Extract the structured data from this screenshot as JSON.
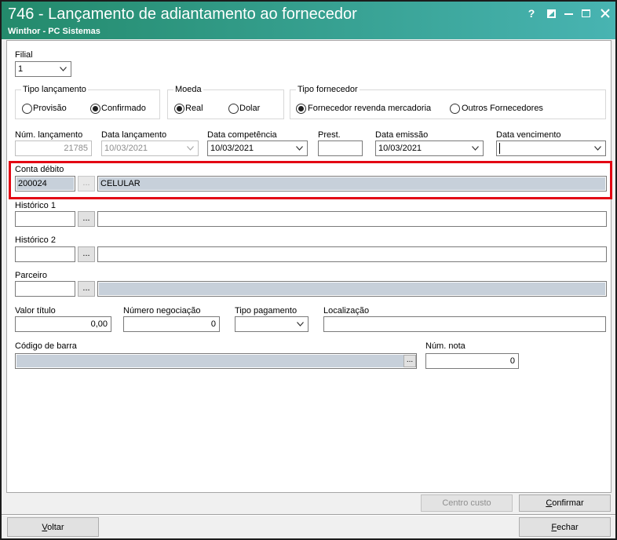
{
  "window": {
    "title": "746 - Lançamento de adiantamento ao fornecedor",
    "subtitle": "Winthor - PC Sistemas",
    "help": "?",
    "control_icons": [
      "help-icon",
      "dock-icon",
      "minimize-icon",
      "maximize-icon",
      "close-icon"
    ]
  },
  "filial": {
    "label": "Filial",
    "value": "1"
  },
  "tipo_lancamento": {
    "legend": "Tipo lançamento",
    "options": [
      {
        "label": "Provisão",
        "checked": false
      },
      {
        "label": "Confirmado",
        "checked": true
      }
    ]
  },
  "moeda": {
    "legend": "Moeda",
    "options": [
      {
        "label": "Real",
        "checked": true
      },
      {
        "label": "Dolar",
        "checked": false
      }
    ]
  },
  "tipo_fornecedor": {
    "legend": "Tipo fornecedor",
    "options": [
      {
        "label": "Fornecedor revenda mercadoria",
        "checked": true
      },
      {
        "label": "Outros Fornecedores",
        "checked": false
      }
    ]
  },
  "num_lancamento": {
    "label": "Núm. lançamento",
    "value": "21785"
  },
  "data_lancamento": {
    "label": "Data lançamento",
    "value": "10/03/2021"
  },
  "data_competencia": {
    "label": "Data competência",
    "value": "10/03/2021"
  },
  "prest": {
    "label": "Prest.",
    "value": ""
  },
  "data_emissao": {
    "label": "Data emissão",
    "value": "10/03/2021"
  },
  "data_vencimento": {
    "label": "Data vencimento",
    "value": ""
  },
  "conta_debito": {
    "label": "Conta débito",
    "code": "200024",
    "browse": "...",
    "description": "CELULAR"
  },
  "historico_1": {
    "label": "Histórico 1",
    "code": "",
    "browse": "...",
    "description": ""
  },
  "historico_2": {
    "label": "Histórico 2",
    "code": "",
    "browse": "...",
    "description": ""
  },
  "parceiro": {
    "label": "Parceiro",
    "code": "",
    "browse": "...",
    "description": ""
  },
  "valor_titulo": {
    "label": "Valor título",
    "value": "0,00"
  },
  "numero_negociacao": {
    "label": "Número negociação",
    "value": "0"
  },
  "tipo_pagamento": {
    "label": "Tipo pagamento",
    "value": ""
  },
  "localizacao": {
    "label": "Localização",
    "value": ""
  },
  "codigo_barra": {
    "label": "Código de barra",
    "value": "",
    "browse": "..."
  },
  "num_nota": {
    "label": "Núm. nota",
    "value": "0"
  },
  "buttons": {
    "centro_custo": "Centro custo",
    "confirmar": "Confirmar",
    "voltar": "Voltar",
    "fechar": "Fechar"
  },
  "colors": {
    "titlebar_start": "#238a6b",
    "titlebar_end": "#48b4b2",
    "highlight": "#e30613",
    "readonly_field": "#c7d0da"
  }
}
